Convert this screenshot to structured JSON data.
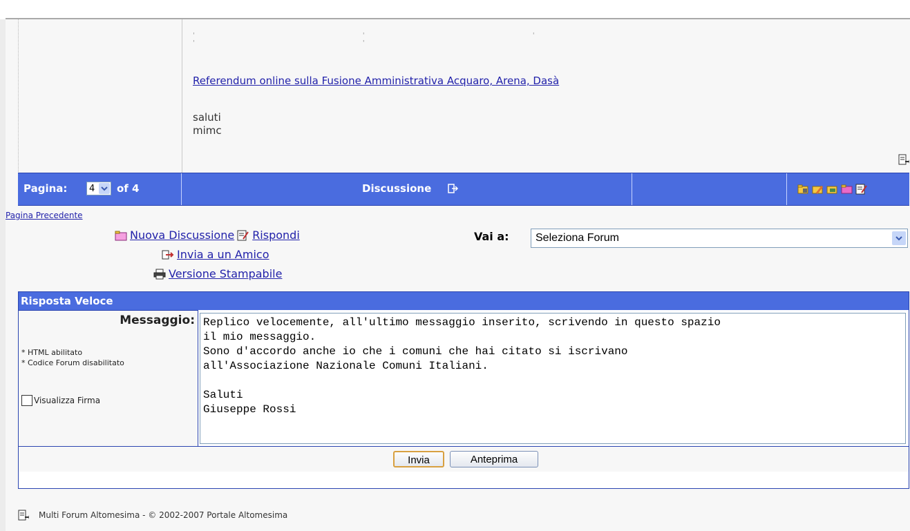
{
  "post": {
    "link_text": "Referendum online sulla Fusione Amministrativa Acquaro, Arena, Dasà",
    "closing_lines": [
      "saluti",
      "mimc"
    ]
  },
  "bar": {
    "page_label": "Pagina:",
    "page_value": "4",
    "of_label": "of 4",
    "topic_label": "Discussione"
  },
  "nav": {
    "previous_page": "Pagina Precedente",
    "new_topic": "Nuova Discussione",
    "reply": "Rispondi",
    "send_friend": "Invia a un Amico",
    "print_version": "Versione Stampabile",
    "jump_label": "Vai a:",
    "forum_select": "Seleziona Forum"
  },
  "quick_reply": {
    "title": "Risposta Veloce",
    "message_label": "Messaggio:",
    "html_note": "* HTML abilitato",
    "code_note": "* Codice Forum disabilitato",
    "signature_label": "Visualizza Firma",
    "message_text": "Replico velocemente, all'ultimo messaggio inserito, scrivendo in questo spazio\nil mio messaggio.\nSono d'accordo anche io che i comuni che hai citato si iscrivano\nall'Associazione Nazionale Comuni Italiani.\n\nSaluti\nGiuseppe Rossi",
    "submit_label": "Invia",
    "preview_label": "Anteprima"
  },
  "footer": {
    "text": "Multi Forum Altomesima - © 2002-2007 Portale Altomesima"
  },
  "colors": {
    "bar_blue": "#4a6cdf",
    "link_blue": "#2222aa"
  }
}
